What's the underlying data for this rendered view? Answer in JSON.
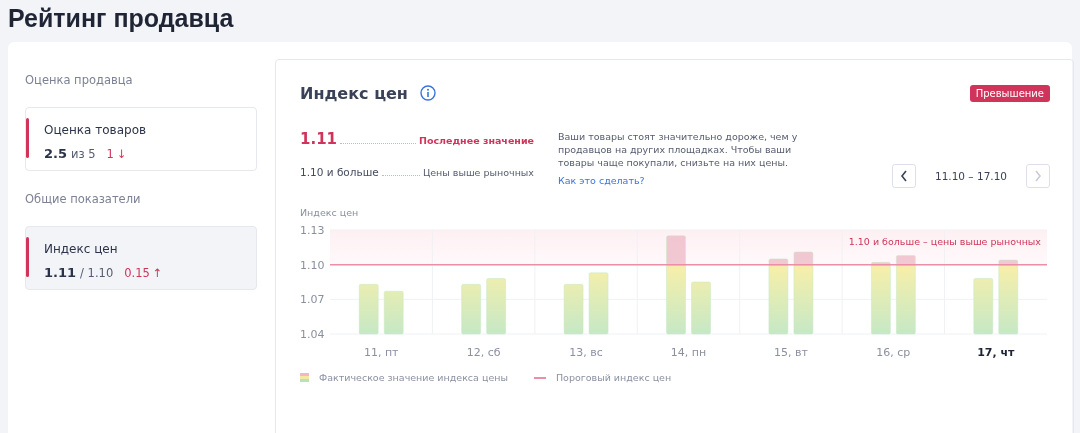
{
  "page_title": "Рейтинг продавца",
  "sidebar": {
    "sections": [
      {
        "heading": "Оценка продавца",
        "metrics": [
          {
            "title": "Оценка товаров",
            "value": "2.5",
            "suffix": "из 5",
            "delta": "1",
            "arrow": "↓",
            "selected": false
          }
        ]
      },
      {
        "heading": "Общие показатели",
        "metrics": [
          {
            "title": "Индекс цен",
            "value": "1.11",
            "suffix": "/ 1.10",
            "delta": "0.15",
            "arrow": "↑",
            "selected": true
          }
        ]
      }
    ]
  },
  "price_index": {
    "title": "Индекс цен",
    "badge": "Превышение",
    "rows": [
      {
        "value": "1.11",
        "label": "Последнее значение",
        "kind": "current"
      },
      {
        "value": "1.10 и больше",
        "label": "Цены выше рыночных",
        "kind": "threshold"
      }
    ],
    "description": "Ваши товары стоят значительно дороже, чем у продавцов на других площадках. Чтобы ваши товары чаще покупали, снизьте на них цены.",
    "link": "Как это сделать?",
    "period": {
      "range": "11.10 – 17.10",
      "prev_disabled": false,
      "next_disabled": true
    },
    "chart_data": {
      "type": "bar",
      "ylabel": "Индекс цен",
      "categories": [
        "11, пт",
        "12, сб",
        "13, вс",
        "14, пн",
        "15, вт",
        "16, ср",
        "17, чт"
      ],
      "series": [
        {
          "color": "#c6e8c6",
          "values": [
            1.083,
            1.083,
            1.083,
            1.125,
            1.105,
            1.102,
            1.088
          ]
        },
        {
          "color": "#c6e8c6",
          "values": [
            1.077,
            1.088,
            1.093,
            1.085,
            1.111,
            1.108,
            1.104
          ]
        }
      ],
      "ylim": [
        1.04,
        1.13
      ],
      "yticks": [
        1.04,
        1.07,
        {
          "value": 1.1,
          "label": "1.10"
        },
        1.13
      ],
      "ref_lines": [
        {
          "axis": "y",
          "value": 1.1,
          "label": "1.10 и больше – цены выше рыночных"
        }
      ],
      "bands": [
        {
          "axis": "y",
          "from": 1.1,
          "to": 1.13
        }
      ]
    },
    "last_day_highlighted": true,
    "legend": [
      {
        "label": "Фактическое значение индекса цены",
        "kind": "bar"
      },
      {
        "label": "Пороговый индекс цен",
        "kind": "line"
      }
    ]
  }
}
